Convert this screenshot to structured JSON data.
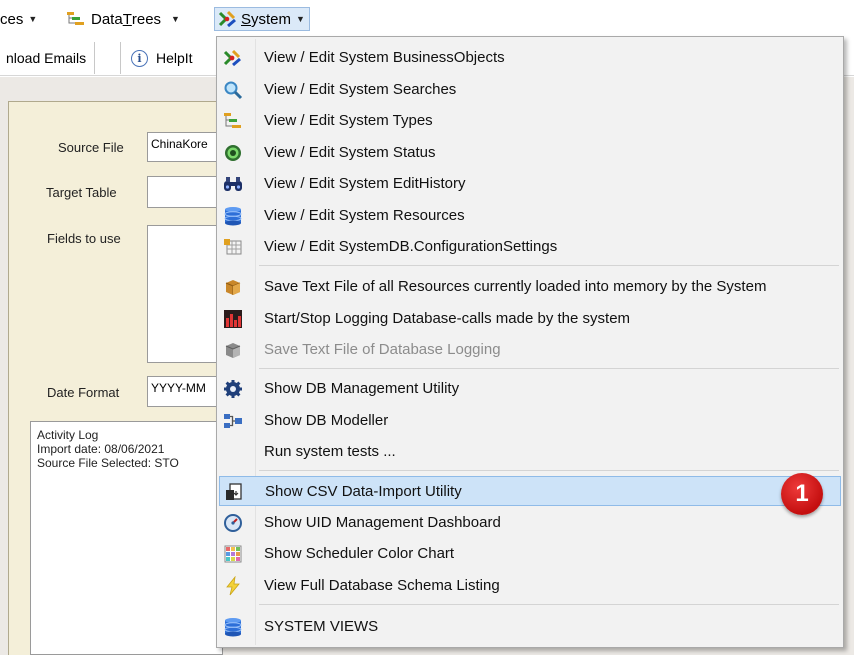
{
  "menubar": {
    "resources_label": "ces",
    "datatrees_prefix": "Data ",
    "datatrees_underlined": "T",
    "datatrees_suffix": "rees",
    "system_underlined": "S",
    "system_suffix": "ystem"
  },
  "tabs": [
    {
      "label": "nload Emails"
    },
    {
      "label": "HelpIt"
    }
  ],
  "form": {
    "source_file_label": "Source File",
    "source_file_value": "ChinaKore",
    "target_table_label": "Target Table",
    "target_table_value": "",
    "fields_label": "Fields to use",
    "date_format_label": "Date Format",
    "date_format_value": "YYYY-MM"
  },
  "activity_log": [
    "Activity Log",
    "Import date: 08/06/2021",
    "Source File Selected: STO"
  ],
  "menu": {
    "items": [
      {
        "label": "View / Edit System BusinessObjects",
        "icon": "business-objects-icon"
      },
      {
        "label": "View / Edit System Searches",
        "icon": "magnifier-icon"
      },
      {
        "label": "View / Edit System Types",
        "icon": "tree-types-icon"
      },
      {
        "label": "View / Edit System Status",
        "icon": "status-icon"
      },
      {
        "label": "View / Edit System EditHistory",
        "icon": "binoculars-icon"
      },
      {
        "label": "View / Edit System Resources",
        "icon": "database-icon"
      },
      {
        "label": "View / Edit SystemDB.ConfigurationSettings",
        "icon": "config-table-icon"
      },
      {
        "label": "Save Text File of all Resources currently loaded into memory by the System",
        "icon": "box-icon"
      },
      {
        "label": "Start/Stop Logging Database-calls made by the system",
        "icon": "bar-chart-icon"
      },
      {
        "label": "Save Text File of Database Logging",
        "icon": "grey-box-icon"
      },
      {
        "label": "Show DB Management Utility",
        "icon": "gear-icon"
      },
      {
        "label": "Show DB Modeller",
        "icon": "modeller-icon"
      },
      {
        "label": "Run system tests ...",
        "icon": ""
      },
      {
        "label": "Show CSV Data-Import Utility",
        "icon": "csv-import-icon"
      },
      {
        "label": "Show UID Management Dashboard",
        "icon": "gauge-icon"
      },
      {
        "label": "Show Scheduler Color Chart",
        "icon": "color-grid-icon"
      },
      {
        "label": "View Full Database Schema Listing",
        "icon": "lightning-icon"
      },
      {
        "label": "SYSTEM VIEWS",
        "icon": "database-icon"
      }
    ]
  },
  "badge": {
    "number": "1"
  },
  "colors": {
    "highlight": "#cde3f8",
    "panel": "#f4efd9",
    "badge": "#d41414"
  }
}
